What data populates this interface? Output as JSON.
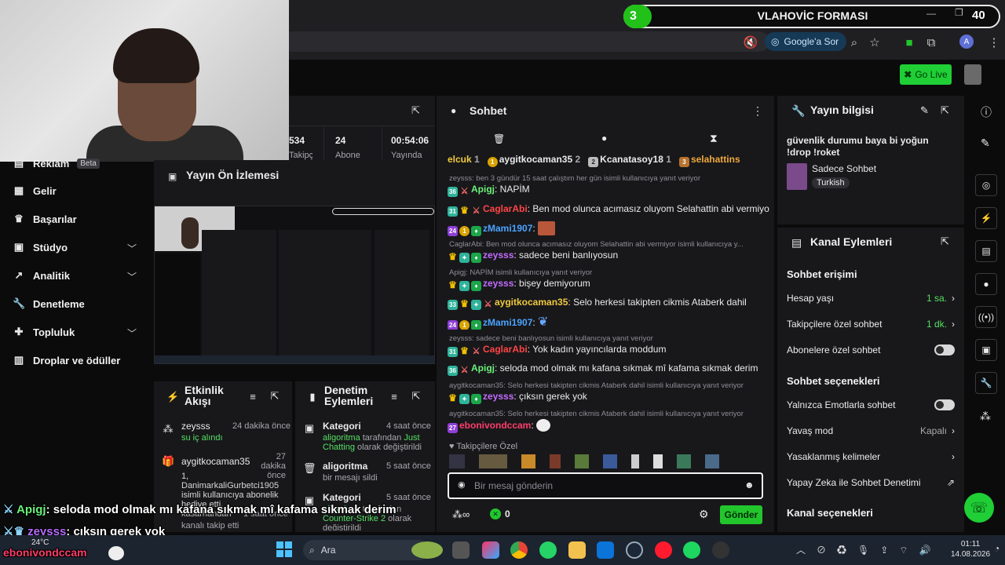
{
  "browser": {
    "ask_label": "Google'a Sor",
    "profile_initial": "A"
  },
  "banner": {
    "number": "3",
    "title": "VLAHOVİC FORMASI",
    "count": "40"
  },
  "header": {
    "go_live": "Go Live"
  },
  "sidebar": {
    "items": [
      {
        "label": "Reklam",
        "icon": "ad-icon",
        "badge": "Beta"
      },
      {
        "label": "Gelir",
        "icon": "revenue-icon"
      },
      {
        "label": "Başarılar",
        "icon": "trophy-icon"
      },
      {
        "label": "Stüdyo",
        "icon": "studio-icon"
      },
      {
        "label": "Analitik",
        "icon": "analytics-icon"
      },
      {
        "label": "Denetleme",
        "icon": "wrench-icon"
      },
      {
        "label": "Topluluk",
        "icon": "community-icon"
      },
      {
        "label": "Droplar ve ödüller",
        "icon": "drops-icon"
      }
    ]
  },
  "stats": {
    "viewers": "534",
    "followers_label": "Takipçi",
    "subs": "24",
    "subs_label": "Abone",
    "uptime": "00:54:06",
    "uptime_label": "Yayında"
  },
  "preview": {
    "title": "Yayın Ön İzlemesi"
  },
  "activity": {
    "title": "Etkinlik Akışı",
    "items": [
      {
        "user": "zeysss",
        "time": "24 dakika önce",
        "detail": "su iç alındı"
      },
      {
        "user": "aygitkocaman35",
        "time": "27 dakika önce",
        "detail": "1, DanimarkaliGurbetci1905 isimli kullanıcıya abonelik hediye etti."
      },
      {
        "user": "kasarhandan",
        "time": "1 saat önce",
        "detail": "kanalı takip etti"
      }
    ]
  },
  "mod_actions": {
    "title": "Denetim Eylemleri",
    "items": [
      {
        "title": "Kategori",
        "time": "4 saat önce",
        "user": "aligoritma",
        "text1": "tarafından",
        "cat": "Just Chatting",
        "text2": "olarak değiştirildi"
      },
      {
        "title": "aligoritma",
        "time": "5 saat önce",
        "text": "bir mesajı sildi"
      },
      {
        "title": "Kategori",
        "time": "5 saat önce",
        "user": "aligoritma",
        "text1": "tarafından",
        "cat": "Counter-Strike 2",
        "text2": "olarak değiştirildi"
      }
    ]
  },
  "chat": {
    "title": "Sohbet",
    "leaders": [
      {
        "rank": "",
        "name": "elcuk",
        "count": "1"
      },
      {
        "rank": "1",
        "name": "aygitkocaman35",
        "count": "2"
      },
      {
        "rank": "2",
        "name": "Kcanatasoy18",
        "count": "1"
      },
      {
        "rank": "3",
        "name": "selahattins"
      }
    ],
    "messages": [
      {
        "reply": "zeysss: ben 3 gündür 15 saat çalıştım her gün isimli kullanıcıya yanıt veriyor",
        "sub": "36",
        "user": "Apigj",
        "color": "#6cf07a",
        "text": "NAPİM"
      },
      {
        "sub": "31",
        "user": "CaglarAbi",
        "color": "#ff4545",
        "text": "Ben mod olunca acımasız oluyom Selahattin abi vermiyor"
      },
      {
        "sub": "24",
        "user": "zMami1907",
        "color": "#4aa3ff",
        "text": ""
      },
      {
        "reply": "CaglarAbi: Ben mod olunca acımasız oluyom Selahattin abi vermiyor isimli kullanıcıya y...",
        "user": "zeysss",
        "color": "#c46cff",
        "text": "sadece beni banlıyosun"
      },
      {
        "reply": "Apigj: NAPİM isimli kullanıcıya yanıt veriyor",
        "user": "zeysss",
        "color": "#c46cff",
        "text": "bişey demiyorum"
      },
      {
        "sub": "33",
        "user": "aygitkocaman35",
        "color": "#f0c93c",
        "text": "Selo herkesi takipten cikmis Ataberk dahil"
      },
      {
        "sub": "24",
        "user": "zMami1907",
        "color": "#4aa3ff",
        "text": ""
      },
      {
        "reply": "zeysss: sadece beni banlıyosun isimli kullanıcıya yanıt veriyor",
        "sub": "31",
        "user": "CaglarAbi",
        "color": "#ff4545",
        "text": "Yok kadın yayıncılarda moddum"
      },
      {
        "sub": "36",
        "user": "Apigj",
        "color": "#6cf07a",
        "text": "seloda mod olmak mı kafana sıkmak mî kafama sıkmak derim"
      },
      {
        "reply": "aygitkocaman35: Selo herkesi takipten cikmis Ataberk dahil isimli kullanıcıya yanıt veriyor",
        "user": "zeysss",
        "color": "#c46cff",
        "text": "çıksın gerek yok"
      },
      {
        "reply": "aygitkocaman35: Selo herkesi takipten cikmis Ataberk dahil isimli kullanıcıya yanıt veriyor",
        "sub": "27",
        "user": "ebonivondccam",
        "color": "#ff3d6a",
        "text": ""
      }
    ],
    "followers_only": "Takipçilere Özel",
    "input_placeholder": "Bir mesaj gönderin",
    "points": "0",
    "send_label": "Gönder"
  },
  "stream_info": {
    "title": "Yayın bilgisi",
    "stream_title": "güvenlik durumu baya bi yoğun !drop !roket",
    "category": "Sadece Sohbet",
    "tag": "Turkish"
  },
  "channel_actions": {
    "title": "Kanal Eylemleri",
    "chat_access": "Sohbet erişimi",
    "account_age": {
      "label": "Hesap yaşı",
      "value": "1 sa."
    },
    "followers_only": {
      "label": "Takipçilere özel sohbet",
      "value": "1 dk."
    },
    "subs_only": {
      "label": "Abonelere özel sohbet"
    },
    "chat_options": "Sohbet seçenekleri",
    "emote_only": {
      "label": "Yalnızca Emotlarla sohbet"
    },
    "slow_mode": {
      "label": "Yavaş mod",
      "value": "Kapalı"
    },
    "banned_words": {
      "label": "Yasaklanmış kelimeler"
    },
    "ai_mod": {
      "label": "Yapay Zeka ile Sohbet Denetimi"
    },
    "channel_options": "Kanal seçenekleri"
  },
  "overlay": {
    "line1_user": "Apigj",
    "line1_text": ": seloda mod olmak mı kafana sıkmak mî kafama sıkmak derim",
    "line2_user": "zeysss",
    "line2_text": ": çıksın gerek yok",
    "line3_user": "ebonivondccam"
  },
  "taskbar": {
    "weather": "24°C",
    "search": "Ara",
    "time": "01:11",
    "date": "14.08.2026"
  },
  "colors": {
    "accent": "#22c62c",
    "panel": "#18181b",
    "background": "#0b0b0c"
  }
}
